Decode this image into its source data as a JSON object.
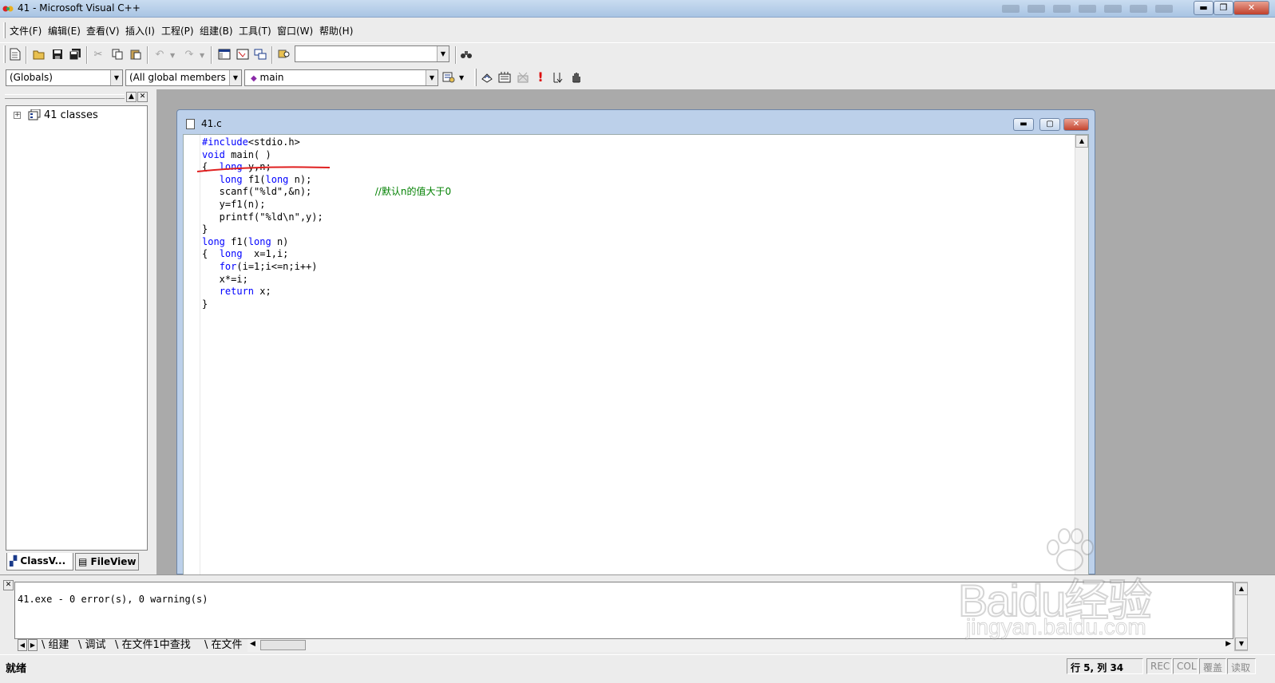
{
  "window": {
    "title": "41 - Microsoft Visual C++",
    "minimize_glyph": "▬",
    "maximize_glyph": "❐",
    "close_glyph": "✕"
  },
  "menu": {
    "items": [
      "文件(F)",
      "编辑(E)",
      "查看(V)",
      "插入(I)",
      "工程(P)",
      "组建(B)",
      "工具(T)",
      "窗口(W)",
      "帮助(H)"
    ]
  },
  "toolbar": {
    "find_combo_value": "",
    "wizard": {
      "class_combo": "(Globals)",
      "filter_combo": "(All global members",
      "members_combo": "main"
    }
  },
  "workspace": {
    "tree_root_label": "41 classes",
    "tabs": [
      "ClassV...",
      "FileView"
    ]
  },
  "document": {
    "title": "41.c",
    "code_lines": [
      [
        {
          "t": "#include",
          "c": "kw"
        },
        {
          "t": "<stdio.h>"
        }
      ],
      [
        {
          "t": "void",
          "c": "kw"
        },
        {
          "t": " main( )"
        }
      ],
      [
        {
          "t": "{  "
        },
        {
          "t": "long",
          "c": "kw"
        },
        {
          "t": " y,n;"
        }
      ],
      [
        {
          "t": "   "
        },
        {
          "t": "long",
          "c": "kw"
        },
        {
          "t": " f1("
        },
        {
          "t": "long",
          "c": "kw"
        },
        {
          "t": " n);"
        }
      ],
      [
        {
          "t": "   scanf(\"%ld\",&n);           "
        },
        {
          "t": "//默认n的值大于0",
          "c": "cm"
        }
      ],
      [
        {
          "t": "   y=f1(n);"
        }
      ],
      [
        {
          "t": "   printf(\"%ld\\n\",y);"
        }
      ],
      [
        {
          "t": "}"
        }
      ],
      [
        {
          "t": "long",
          "c": "kw"
        },
        {
          "t": " f1("
        },
        {
          "t": "long",
          "c": "kw"
        },
        {
          "t": " n)"
        }
      ],
      [
        {
          "t": "{  "
        },
        {
          "t": "long",
          "c": "kw"
        },
        {
          "t": "  x=1,i;"
        }
      ],
      [
        {
          "t": "   "
        },
        {
          "t": "for",
          "c": "kw"
        },
        {
          "t": "(i=1;i<=n;i++)"
        }
      ],
      [
        {
          "t": "   x*=i;"
        }
      ],
      [
        {
          "t": "   "
        },
        {
          "t": "return",
          "c": "kw"
        },
        {
          "t": " x;"
        }
      ],
      [
        {
          "t": "}"
        }
      ]
    ]
  },
  "output": {
    "text": "41.exe - 0 error(s), 0 warning(s)",
    "tabs": [
      "组建",
      "调试",
      "在文件1中查找",
      "在文件"
    ]
  },
  "status": {
    "text": "就绪",
    "position": "行 5, 列 34",
    "indicators": [
      "REC",
      "COL",
      "覆盖",
      "读取"
    ]
  },
  "watermark": {
    "brand": "Baidu经验",
    "url": "jingyan.baidu.com"
  },
  "colors": {
    "keyword": "#0000ff",
    "comment": "#008000",
    "annotation_underline": "#e02020"
  }
}
